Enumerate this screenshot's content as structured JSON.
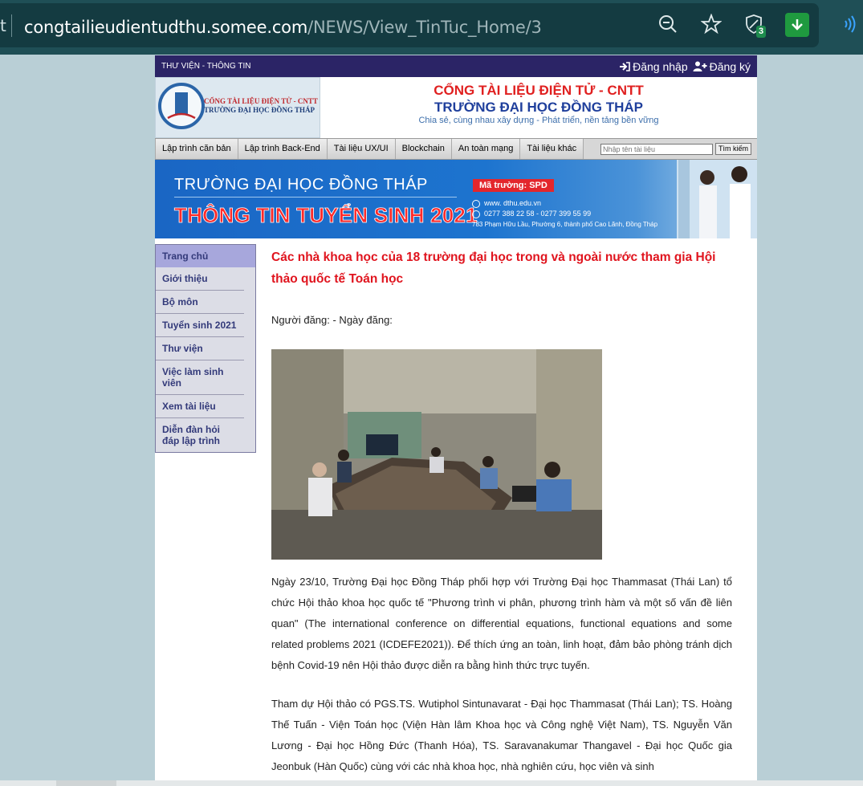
{
  "browser": {
    "url_prefix": "t",
    "url_host": "congtailieudientudthu.somee.com",
    "url_path": "/NEWS/View_TinTuc_Home/3",
    "shield_count": "3"
  },
  "topbar": {
    "library_label": "THƯ VIỆN - THÔNG TIN",
    "login": "Đăng nhập",
    "register": "Đăng ký"
  },
  "header": {
    "logo_line1": "CỔNG TÀI LIỆU ĐIỆN TỬ - CNTT",
    "logo_line2": "TRƯỜNG ĐẠI HỌC ĐỒNG THÁP",
    "title": "CỔNG TÀI LIỆU ĐIỆN TỬ - CNTT",
    "subtitle": "TRƯỜNG ĐẠI HỌC ĐỒNG THÁP",
    "slogan": "Chia sẻ, cùng nhau xây dựng - Phát triển, nền tảng bền vững"
  },
  "nav": {
    "items": [
      "Lập trình căn bản",
      "Lập trình Back-End",
      "Tài liệu UX/UI",
      "Blockchain",
      "An toàn mạng",
      "Tài liệu khác"
    ],
    "search_placeholder": "Nhập tên tài liệu",
    "search_button": "Tìm kiếm"
  },
  "banner": {
    "line1": "TRƯỜNG ĐẠI HỌC ĐỒNG THÁP",
    "line2": "THÔNG TIN TUYỂN SINH 2021",
    "code": "Mã trường: SPD",
    "website": "www. dthu.edu.vn",
    "phone": "0277 388 22 58  -  0277 399 55 99",
    "address": "783 Phạm Hữu Lầu, Phường 6, thành phố Cao Lãnh, Đồng Tháp"
  },
  "sidebar": {
    "items": [
      "Trang chủ",
      "Giới thiệu",
      "Bộ môn",
      "Tuyển sinh 2021",
      "Thư viện",
      "Việc làm sinh viên",
      "Xem tài liệu",
      "Diễn đàn hỏi đáp lập trình"
    ]
  },
  "article": {
    "title": "Các nhà khoa học của 18 trường đại học trong và ngoài nước tham gia Hội thảo quốc tế Toán học",
    "meta": "Người đăng:  - Ngày đăng:",
    "para1": "Ngày 23/10, Trường Đại học Đồng Tháp phối hợp với Trường Đại học Thammasat (Thái Lan) tổ chức Hội thảo khoa học quốc tế \"Phương trình vi phân, phương trình hàm và một số vấn đề liên quan\" (The international conference on differential equations, functional equations and some related problems 2021 (ICDEFE2021)). Để thích ứng an toàn, linh hoạt, đảm bảo phòng tránh dịch bệnh Covid-19 nên Hội thảo được diễn ra bằng hình thức trực tuyến.",
    "para2": "Tham dự Hội thảo có PGS.TS. Wutiphol Sintunavarat - Đại học Thammasat (Thái Lan); TS. Hoàng Thế Tuấn - Viện Toán học (Viện Hàn lâm Khoa học và Công nghệ Việt Nam), TS. Nguyễn Văn Lương - Đại học Hồng Đức (Thanh Hóa), TS. Saravanakumar Thangavel - Đại học Quốc gia Jeonbuk (Hàn Quốc) cùng với các nhà khoa học, nhà nghiên cứu, học viên và sinh"
  },
  "colors": {
    "topbar": "#2b2466",
    "title_red": "#e0141e",
    "sidebar_active": "#a7a7dc"
  }
}
